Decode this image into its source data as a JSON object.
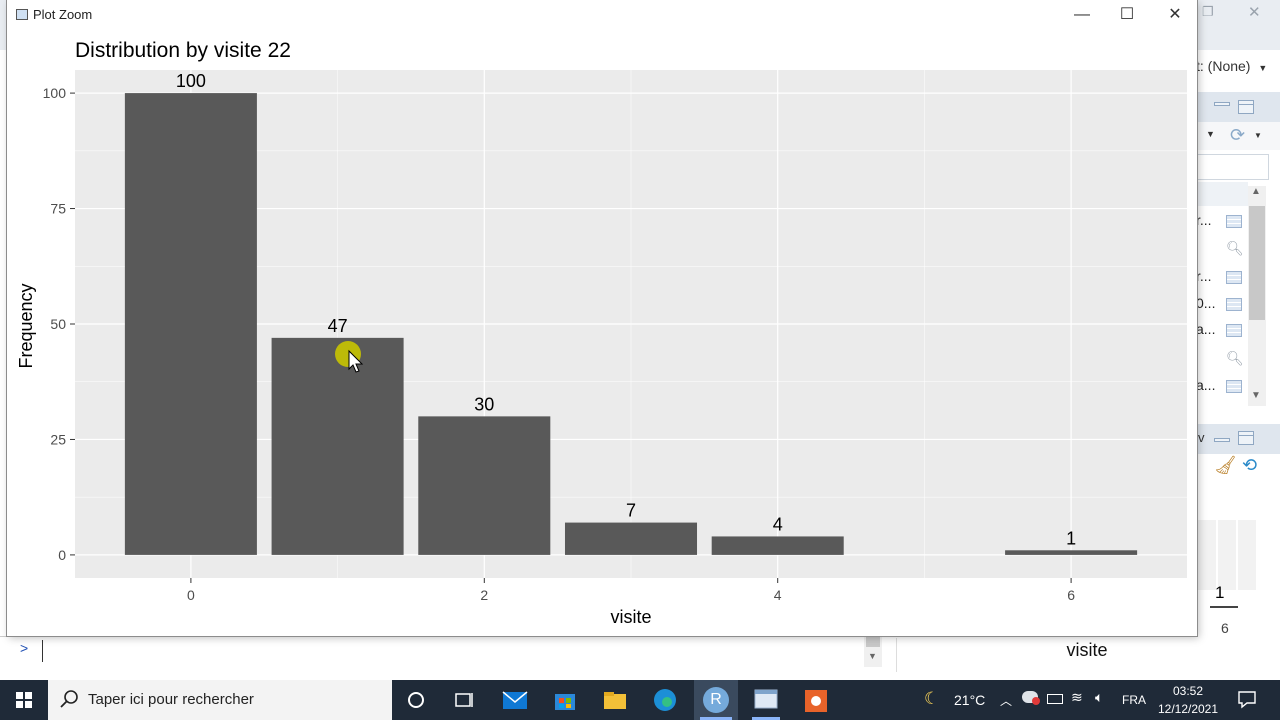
{
  "window": {
    "title": "Plot Zoom",
    "minimize_glyph": "—",
    "maximize_glyph": "☐",
    "close_glyph": "✕"
  },
  "background": {
    "target_label": "t: (None)",
    "list_rows": [
      "r...",
      "",
      "r...",
      "0...",
      "a...",
      "",
      "a..."
    ],
    "console_prompt": ">",
    "bottom_axis_label": "visite",
    "mini_count": "1",
    "mini_tick": "6",
    "pane_label": "v"
  },
  "taskbar": {
    "search_placeholder": "Taper ici pour rechercher",
    "weather_temp": "21°C",
    "language": "FRA",
    "time": "03:52",
    "date": "12/12/2021",
    "r_icon_letter": "R"
  },
  "colors": {
    "panel_bg": "#ebebeb",
    "bar_fill": "#595959",
    "gridline": "#ffffff",
    "taskbar_bg": "#1f2a38",
    "cursor_highlight": "#c8c400"
  },
  "chart_data": {
    "type": "bar",
    "title": "Distribution by visite 22",
    "xlabel": "visite",
    "ylabel": "Frequency",
    "x": [
      0,
      1,
      2,
      3,
      4,
      6
    ],
    "values": [
      100,
      47,
      30,
      7,
      4,
      1
    ],
    "data_labels": [
      "100",
      "47",
      "30",
      "7",
      "4",
      "1"
    ],
    "x_ticks": [
      0,
      2,
      4,
      6
    ],
    "x_tick_labels": [
      "0",
      "2",
      "4",
      "6"
    ],
    "y_ticks": [
      0,
      25,
      50,
      75,
      100
    ],
    "y_tick_labels": [
      "0",
      "25",
      "50",
      "75",
      "100"
    ],
    "xlim": [
      -0.79,
      6.79
    ],
    "ylim": [
      -5,
      105
    ],
    "grid": true,
    "legend": "none"
  }
}
